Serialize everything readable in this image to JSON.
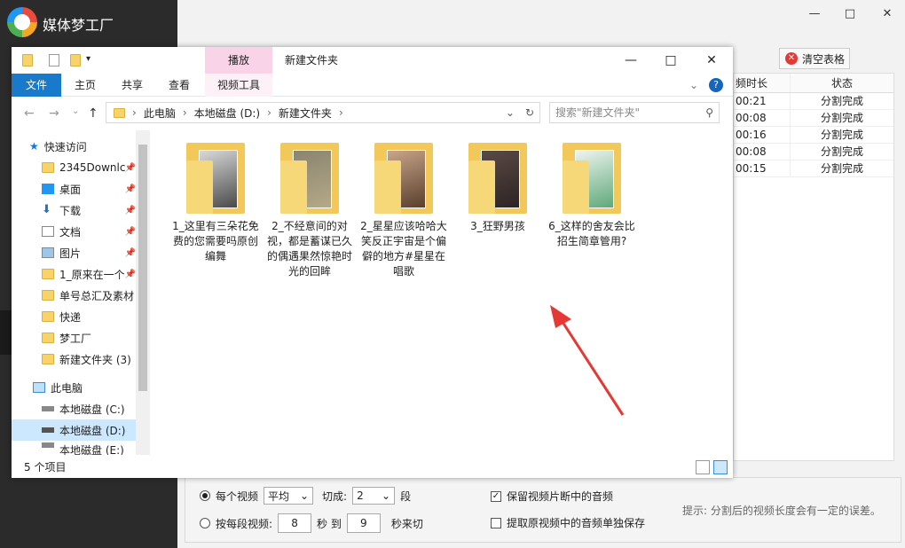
{
  "app": {
    "title": "媒体梦工厂",
    "clear_label": "清空表格",
    "table": {
      "headers": [
        "频时长",
        "状态"
      ],
      "rows": [
        [
          "00:21",
          "分割完成"
        ],
        [
          "00:08",
          "分割完成"
        ],
        [
          "00:16",
          "分割完成"
        ],
        [
          "00:08",
          "分割完成"
        ],
        [
          "00:15",
          "分割完成"
        ]
      ]
    },
    "options": {
      "per_video_label": "每个视频",
      "mode_value": "平均",
      "cut_label": "切成:",
      "cut_value": "2",
      "segments_unit": "段",
      "per_segment_label": "按每段视频:",
      "from_value": "8",
      "sec_label": "秒 到",
      "to_value": "9",
      "sec_cut_label": "秒来切",
      "keep_audio_label": "保留视频片断中的音频",
      "extract_audio_label": "提取原视频中的音频单独保存",
      "hint": "提示: 分割后的视频长度会有一定的误差。"
    }
  },
  "explorer": {
    "context_tab": "播放",
    "window_title": "新建文件夹",
    "tabs": {
      "file": "文件",
      "home": "主页",
      "share": "共享",
      "view": "查看",
      "video_tools": "视频工具"
    },
    "path": [
      "此电脑",
      "本地磁盘 (D:)",
      "新建文件夹"
    ],
    "search_placeholder": "搜索\"新建文件夹\"",
    "nav": {
      "quick_access": "快速访问",
      "items": [
        {
          "label": "2345Downlc",
          "icon": "folder-icon",
          "pinned": true
        },
        {
          "label": "桌面",
          "icon": "desktop-icon",
          "pinned": true
        },
        {
          "label": "下载",
          "icon": "download-icon",
          "pinned": true
        },
        {
          "label": "文档",
          "icon": "document-icon",
          "pinned": true
        },
        {
          "label": "图片",
          "icon": "picture-icon",
          "pinned": true
        },
        {
          "label": "1_原来在一个",
          "icon": "folder-icon",
          "pinned": true
        },
        {
          "label": "单号总汇及素材",
          "icon": "folder-icon",
          "pinned": false
        },
        {
          "label": "快递",
          "icon": "folder-icon",
          "pinned": false
        },
        {
          "label": "梦工厂",
          "icon": "folder-icon",
          "pinned": false
        },
        {
          "label": "新建文件夹 (3)",
          "icon": "folder-icon",
          "pinned": false
        }
      ],
      "this_pc": "此电脑",
      "drives": [
        "本地磁盘 (C:)",
        "本地磁盘 (D:)",
        "本地磁盘 (E:)"
      ]
    },
    "files": [
      {
        "name": "1_这里有三朵花免费的您需要吗原创编舞"
      },
      {
        "name": "2_不经意间的对视，都是蓄谋已久的偶遇果然惊艳时光的回眸"
      },
      {
        "name": "2_星星应该哈哈大笑反正宇宙是个偏僻的地方#星星在唱歌"
      },
      {
        "name": "3_狂野男孩"
      },
      {
        "name": "6_这样的舍友会比招生简章管用?"
      }
    ],
    "status": "5 个项目"
  }
}
